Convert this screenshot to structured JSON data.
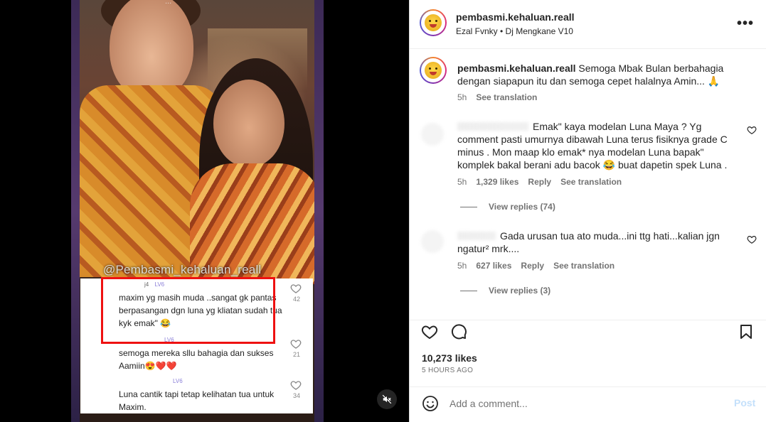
{
  "video": {
    "watermark": "@Pembasmi_kehaluan_reall",
    "top_overlay": "...",
    "card_comments": [
      {
        "user_level": "LV6",
        "text": "maxim yg masih muda ..sangat gk pantas berpasangan dgn luna yg kliatan sudah tua kyk emak\" 😂",
        "likes": "42"
      },
      {
        "user_level": "LV6",
        "text": "semoga mereka sllu bahagia dan sukses Aamiin😍❤️❤️",
        "likes": "21"
      },
      {
        "user_level": "LV6",
        "text": "Luna cantik tapi tetap kelihatan tua untuk  Maxim.",
        "likes": "34"
      }
    ],
    "user_prefix_1": "j4"
  },
  "header": {
    "username": "pembasmi.kehaluan.reall",
    "music": "Ezal Fvnky • Dj Mengkane V10"
  },
  "caption": {
    "username": "pembasmi.kehaluan.reall",
    "text": "Semoga Mbak Bulan berbahagia dengan siapapun itu dan semoga cepet halalnya Amin... 🙏",
    "age": "5h",
    "see_translation": "See translation"
  },
  "comments": [
    {
      "text": "Emak\" kaya modelan Luna Maya ? Yg comment pasti umurnya dibawah Luna terus fisiknya grade C minus . Mon maap klo emak* nya modelan Luna bapak\" komplek bakal berani adu bacok 😂 buat dapetin spek Luna .",
      "age": "5h",
      "likes": "1,329 likes",
      "reply": "Reply",
      "see_translation": "See translation",
      "view_replies": "View replies (74)"
    },
    {
      "text": "Gada urusan tua ato muda...ini ttg hati...kalian jgn ngatur² mrk....",
      "age": "5h",
      "likes": "627 likes",
      "reply": "Reply",
      "see_translation": "See translation",
      "view_replies": "View replies (3)"
    }
  ],
  "actions": {
    "likes": "10,273 likes",
    "time_ago": "5 HOURS AGO"
  },
  "add_comment": {
    "placeholder": "Add a comment...",
    "post_label": "Post"
  },
  "icons": {
    "heart": "heart-icon",
    "comment": "comment-icon",
    "bookmark": "bookmark-icon",
    "more": "more-options-icon",
    "emoji": "emoji-icon",
    "mute": "muted-speaker-icon"
  },
  "colors": {
    "highlight": "#e11111",
    "post_disabled": "#c4e0fb"
  }
}
